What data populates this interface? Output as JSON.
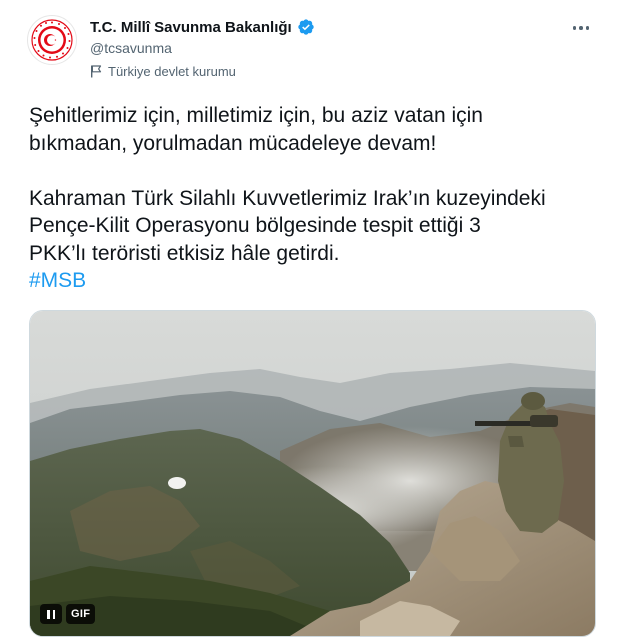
{
  "account": {
    "display_name": "T.C. Millî Savunma Bakanlığı",
    "handle": "@tcsavunma",
    "label": "Türkiye devlet kurumu",
    "verified": true
  },
  "tweet": {
    "line1": "Şehitlerimiz için, milletimiz için, bu aziz vatan için",
    "line2": "bıkmadan, yorulmadan mücadeleye devam!",
    "line3": "Kahraman Türk Silahlı Kuvvetlerimiz Irak’ın kuzeyindeki",
    "line4": "Pençe-Kilit Operasyonu bölgesinde tespit ettiği 3",
    "line5": "PKK’lı teröristi etkisiz hâle getirdi.",
    "hashtag": "#MSB"
  },
  "media": {
    "type": "gif",
    "badge": "GIF"
  },
  "colors": {
    "accent": "#1d9bf0",
    "text": "#0f1419",
    "secondary": "#536471",
    "logo_red": "#e30a17"
  }
}
